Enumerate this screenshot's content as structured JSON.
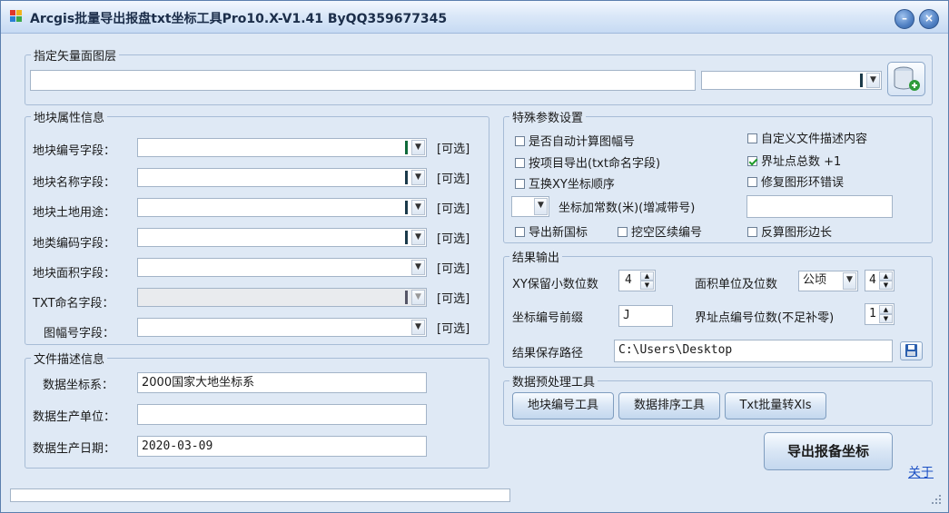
{
  "window": {
    "title": "Arcgis批量导出报盘txt坐标工具Pro10.X-V1.41 ByQQ359677345"
  },
  "layer": {
    "group_title": "指定矢量面图层",
    "path_value": "",
    "combo_value": ""
  },
  "attr": {
    "group_title": "地块属性信息",
    "optional": "[可选]",
    "fields": [
      {
        "label": "地块编号字段：",
        "value": ""
      },
      {
        "label": "地块名称字段：",
        "value": ""
      },
      {
        "label": "地块土地用途：",
        "value": ""
      },
      {
        "label": "地类编码字段：",
        "value": ""
      },
      {
        "label": "地块面积字段：",
        "value": ""
      },
      {
        "label": "TXT命名字段：",
        "value": ""
      },
      {
        "label": "图幅号字段：",
        "value": ""
      }
    ]
  },
  "file_desc": {
    "group_title": "文件描述信息",
    "coord_label": "数据坐标系：",
    "coord_value": "2000国家大地坐标系",
    "unit_label": "数据生产单位：",
    "unit_value": "",
    "date_label": "数据生产日期：",
    "date_value": "2020-03-09"
  },
  "special": {
    "group_title": "特殊参数设置",
    "cb_auto_sheet": "是否自动计算图幅号",
    "cb_custom_desc": "自定义文件描述内容",
    "cb_by_item": "按项目导出(txt命名字段)",
    "cb_boundary_total": "界址点总数 +1",
    "cb_swap_xy": "互换XY坐标顺序",
    "cb_fix_ring": "修复图形环错误",
    "const_label": "坐标加常数(米)(增减带号)",
    "const_combo_value": "",
    "const_value": "",
    "cb_new_gb": "导出新国标",
    "cb_hole": "挖空区续编号",
    "cb_reverse": "反算图形边长",
    "checked_boundary_total": true
  },
  "result": {
    "group_title": "结果输出",
    "xy_decimals_label": "XY保留小数位数",
    "xy_decimals_value": "4",
    "area_label": "面积单位及位数",
    "area_unit": "公顷",
    "area_decimals": "4",
    "prefix_label": "坐标编号前缀",
    "prefix_value": "J",
    "point_digits_label": "界址点编号位数(不足补零)",
    "point_digits_value": "1",
    "path_label": "结果保存路径",
    "path_value": "C:\\Users\\Desktop"
  },
  "preprocess": {
    "group_title": "数据预处理工具",
    "btn_parcel_no": "地块编号工具",
    "btn_sort": "数据排序工具",
    "btn_txt_xls": "Txt批量转Xls"
  },
  "actions": {
    "export_label": "导出报备坐标",
    "about_label": "关于"
  },
  "status": {
    "progress": 0
  }
}
